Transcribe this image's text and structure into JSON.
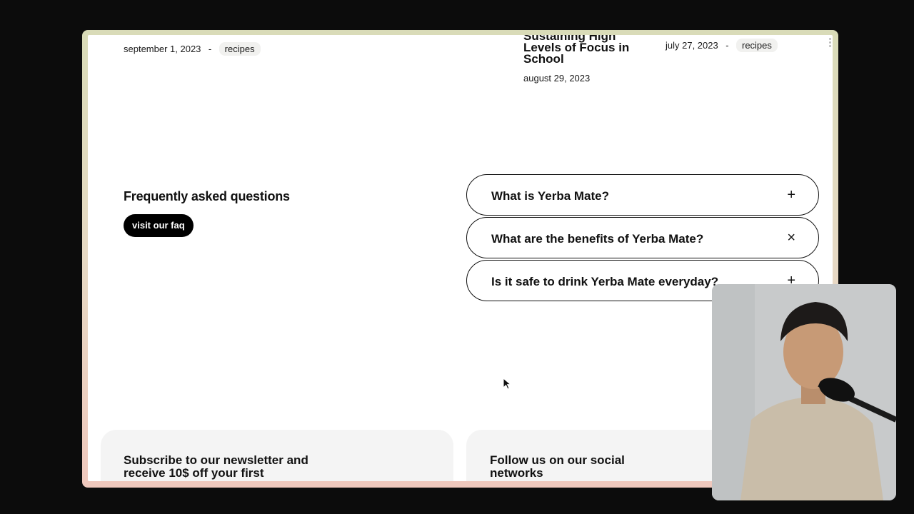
{
  "posts": [
    {
      "date": "september 1, 2023",
      "separator": "-",
      "tag": "recipes"
    },
    {
      "title": "Sustaining High Levels of Focus in School",
      "date": "august 29, 2023"
    },
    {
      "date": "july 27, 2023",
      "separator": "-",
      "tag": "recipes"
    }
  ],
  "faq": {
    "heading": "Frequently asked questions",
    "button_label": "visit our faq",
    "items": [
      {
        "question": "What is Yerba Mate?",
        "icon": "+"
      },
      {
        "question": "What are the benefits of Yerba Mate?",
        "icon": "×"
      },
      {
        "question": "Is it safe to drink Yerba Mate everyday?",
        "icon": "+"
      }
    ]
  },
  "newsletter": {
    "title": "Subscribe to our newsletter and receive 10$ off your first"
  },
  "social": {
    "title": "Follow us on our social networks"
  },
  "icons": {
    "plus": "plus-icon",
    "close": "close-icon",
    "cursor": "mouse-cursor-icon"
  },
  "colors": {
    "background": "#0c0c0c",
    "page": "#ffffff",
    "button": "#000000",
    "card": "#f4f4f4"
  }
}
